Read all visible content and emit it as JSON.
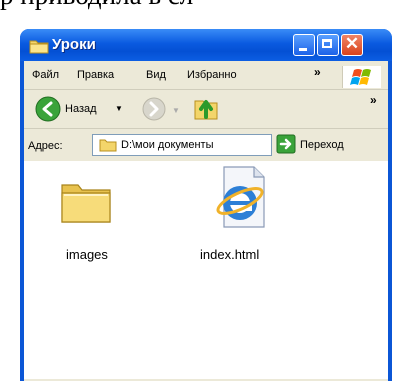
{
  "window": {
    "title": "Уроки",
    "title_folder_icon": "folder-icon",
    "controls": [
      "minimize-icon",
      "maximize-icon",
      "close-icon"
    ],
    "colors": {
      "titlebar": "#0a5ae0",
      "close": "#d9421b",
      "face": "#ece9d8"
    }
  },
  "menu": {
    "items": [
      "Файл",
      "Правка",
      "Вид",
      "Избранно"
    ],
    "more": "»"
  },
  "toolbar": {
    "back_label": "Назад",
    "more": "»"
  },
  "address": {
    "label": "Адрес:",
    "value": "D:\\мои документы",
    "go_label": "Переход"
  },
  "files": [
    {
      "name": "images",
      "icon": "folder-icon"
    },
    {
      "name": "index.html",
      "icon": "internet-explorer-icon"
    }
  ]
}
